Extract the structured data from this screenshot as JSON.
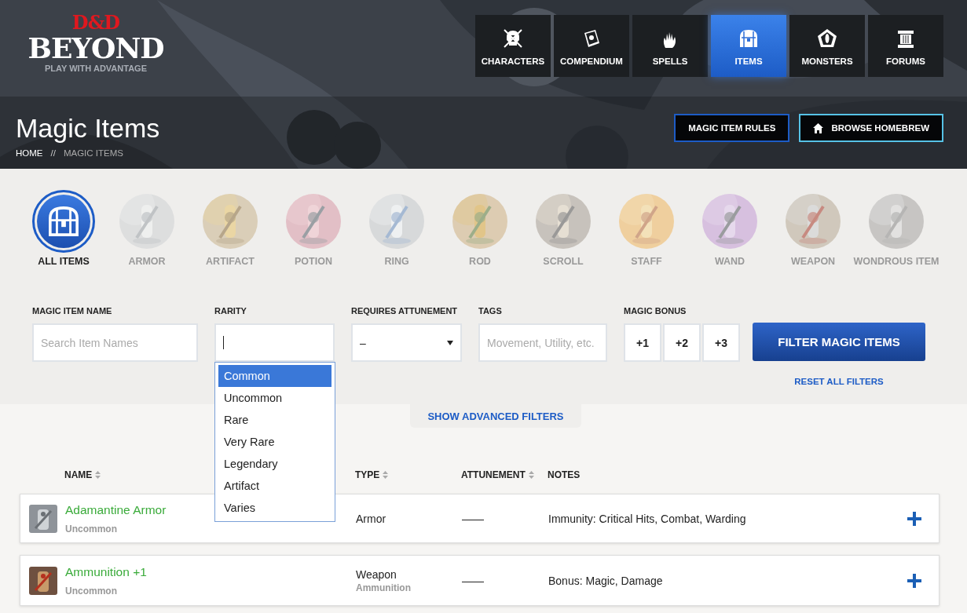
{
  "logo": {
    "mark": "D&D",
    "wordmark": "BEYOND",
    "tagline": "PLAY WITH ADVANTAGE"
  },
  "nav": [
    {
      "label": "CHARACTERS",
      "selected": false
    },
    {
      "label": "COMPENDIUM",
      "selected": false
    },
    {
      "label": "SPELLS",
      "selected": false
    },
    {
      "label": "ITEMS",
      "selected": true
    },
    {
      "label": "MONSTERS",
      "selected": false
    },
    {
      "label": "FORUMS",
      "selected": false
    }
  ],
  "page": {
    "title": "Magic Items",
    "breadcrumb": {
      "home": "HOME",
      "separator": "//",
      "current": "MAGIC ITEMS"
    }
  },
  "header_buttons": [
    {
      "label": "MAGIC ITEM RULES",
      "kind": "plain"
    },
    {
      "label": "BROWSE HOMEBREW",
      "kind": "home"
    }
  ],
  "categories": [
    {
      "label": "ALL ITEMS",
      "kind": "icon",
      "selected": true
    },
    {
      "label": "ARMOR",
      "kind": "picture",
      "selected": false
    },
    {
      "label": "ARTIFACT",
      "kind": "picture",
      "selected": false
    },
    {
      "label": "POTION",
      "kind": "picture",
      "selected": false
    },
    {
      "label": "RING",
      "kind": "picture",
      "selected": false
    },
    {
      "label": "ROD",
      "kind": "picture",
      "selected": false
    },
    {
      "label": "SCROLL",
      "kind": "picture",
      "selected": false
    },
    {
      "label": "STAFF",
      "kind": "picture",
      "selected": false
    },
    {
      "label": "WAND",
      "kind": "picture",
      "selected": false
    },
    {
      "label": "WEAPON",
      "kind": "picture",
      "selected": false
    },
    {
      "label": "WONDROUS ITEM",
      "kind": "picture",
      "selected": false
    }
  ],
  "filters": {
    "name": {
      "label": "MAGIC ITEM NAME",
      "placeholder": "Search Item Names"
    },
    "rarity": {
      "label": "RARITY",
      "expanded": true,
      "options": [
        {
          "label": "Common",
          "selected": true
        },
        {
          "label": "Uncommon",
          "selected": false
        },
        {
          "label": "Rare",
          "selected": false
        },
        {
          "label": "Very Rare",
          "selected": false
        },
        {
          "label": "Legendary",
          "selected": false
        },
        {
          "label": "Artifact",
          "selected": false
        },
        {
          "label": "Varies",
          "selected": false
        }
      ]
    },
    "attunement": {
      "label": "REQUIRES ATTUNEMENT",
      "value": "–"
    },
    "tags": {
      "label": "TAGS",
      "placeholder": "Movement, Utility, etc."
    },
    "magic_bonus": {
      "label": "MAGIC BONUS",
      "options": [
        {
          "label": "+1",
          "selected": false
        },
        {
          "label": "+2",
          "selected": false
        },
        {
          "label": "+3",
          "selected": false
        }
      ]
    },
    "submit": "FILTER MAGIC ITEMS",
    "reset": "RESET ALL FILTERS",
    "advanced": "SHOW ADVANCED FILTERS"
  },
  "table": {
    "columns": [
      {
        "label": "NAME",
        "sortable": true
      },
      {
        "label": "TYPE",
        "sortable": true
      },
      {
        "label": "ATTUNEMENT",
        "sortable": true
      },
      {
        "label": "NOTES",
        "sortable": false
      }
    ],
    "rows": [
      {
        "name": "Adamantine Armor",
        "rarity": "Uncommon",
        "type": "Armor",
        "attunement": "——",
        "notes": "Immunity: Critical Hits, Combat, Warding"
      },
      {
        "name": "Ammunition +1",
        "rarity": "Uncommon",
        "type": "Weapon",
        "subtype": "Ammunition",
        "attunement": "——",
        "notes": "Bonus: Magic, Damage"
      }
    ]
  }
}
